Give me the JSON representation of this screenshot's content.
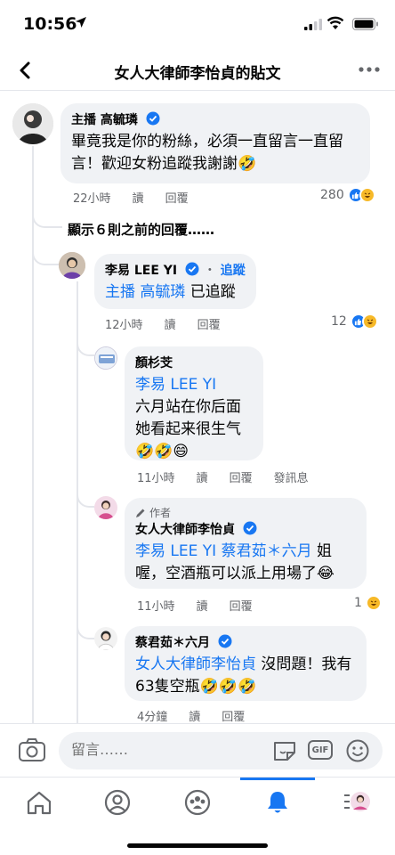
{
  "status_bar": {
    "time": "10:56"
  },
  "nav": {
    "title": "女人大律師李怡貞的貼文"
  },
  "comments": [
    {
      "name": "主播 高毓璘",
      "text": "畢竟我是你的粉絲，必須一直留言一直留言！歡迎女粉追蹤我謝謝🤣",
      "time": "22小時",
      "like_label": "讀",
      "reply_label": "回覆",
      "reaction_count": "280"
    }
  ],
  "show_previous": "顯示６則之前的回覆……",
  "replies": [
    {
      "name": "李易 LEE YI",
      "follow": "追蹤",
      "mention": "主播 高毓璘",
      "text": " 已追蹤",
      "time": "12小時",
      "like_label": "讀",
      "reply_label": "回覆",
      "reaction_count": "12"
    },
    {
      "name": "顏杉芠",
      "mention": "李易 LEE YI",
      "text": "六月站在你后面\n她看起来很生气\n🤣🤣😄",
      "time": "11小時",
      "like_label": "讀",
      "reply_label": "回覆",
      "extra_label": "發訊息"
    },
    {
      "author_tag": "作者",
      "name": "女人大律師李怡貞",
      "mention": "李易 LEE YI 蔡君茹＊六月",
      "text": " 姐喔，空酒瓶可以派上用場了😂",
      "time": "11小時",
      "like_label": "讀",
      "reply_label": "回覆",
      "reaction_count": "1"
    },
    {
      "name": "蔡君茹＊六月",
      "mention": "女人大律師李怡貞",
      "text": " 沒問題！我有63隻空瓶🤣🤣🤣",
      "time": "4分鐘",
      "like_label": "讀",
      "reply_label": "回覆"
    }
  ],
  "input": {
    "placeholder": "留言……",
    "gif_label": "GIF"
  },
  "colors": {
    "accent": "#1877f2",
    "bubble": "#f0f2f5",
    "meta": "#65676b"
  }
}
